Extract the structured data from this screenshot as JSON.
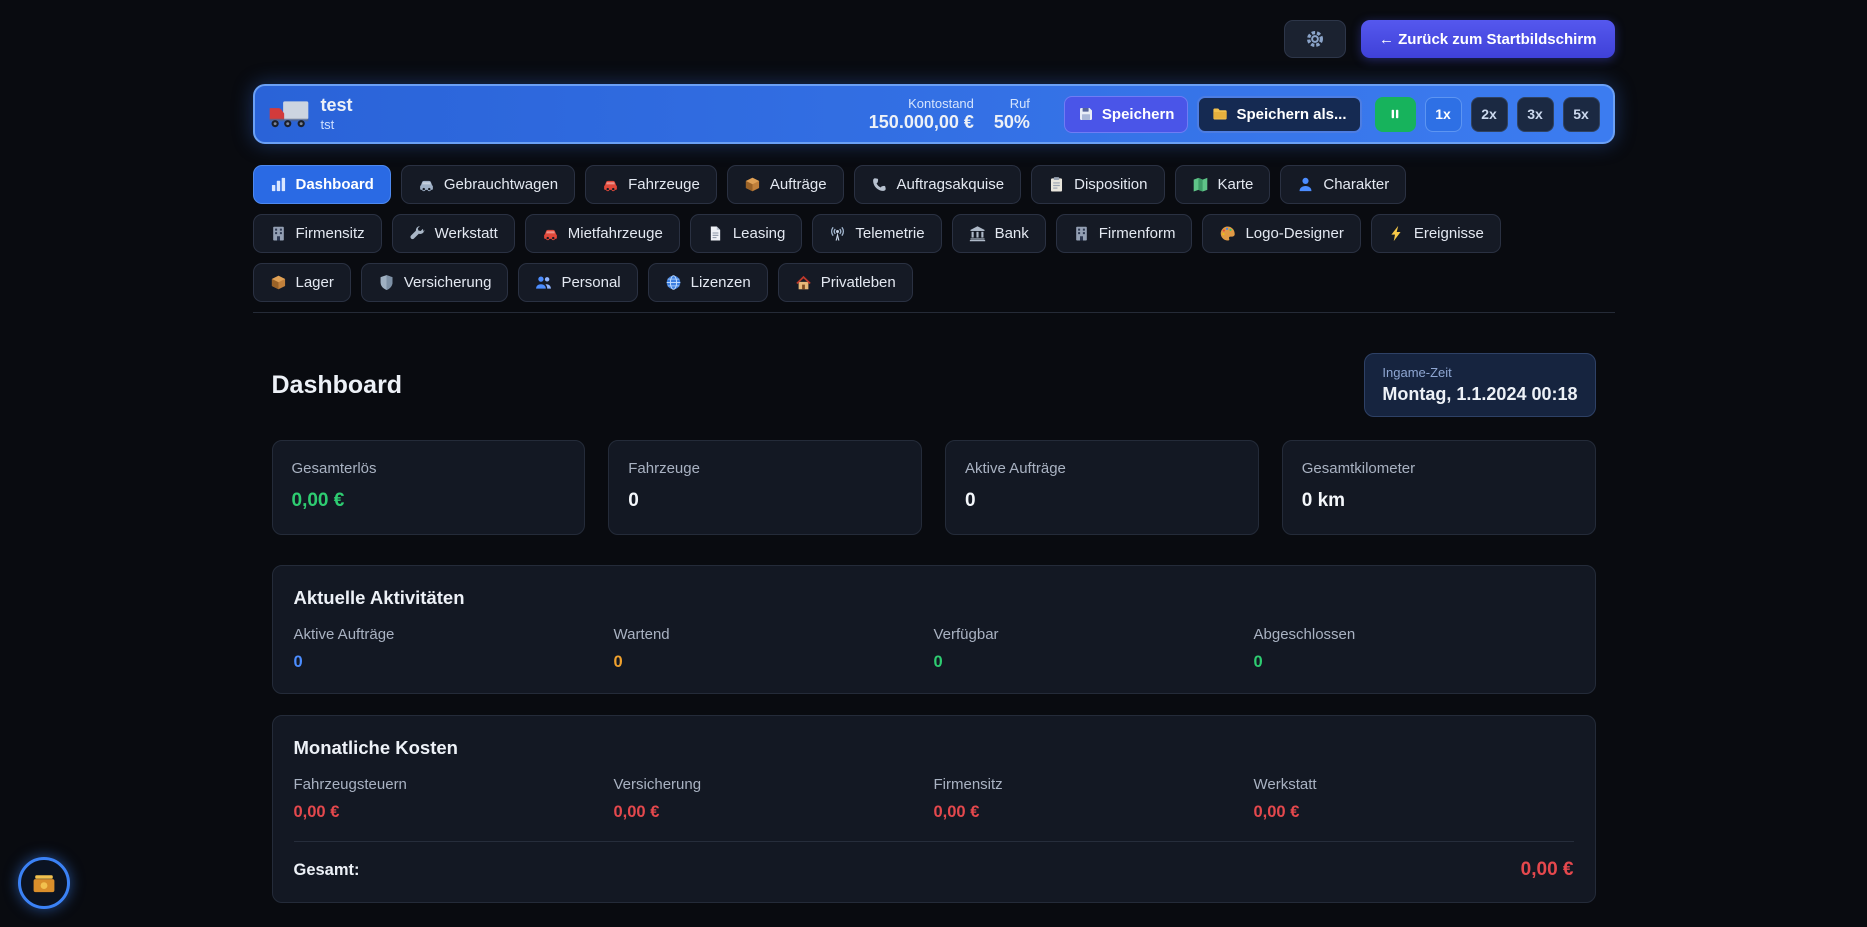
{
  "colors": {
    "accent_blue": "#2e6fe4",
    "green": "#2ecc71",
    "red": "#e5484d",
    "orange": "#f0a12e",
    "blue": "#4c8dff"
  },
  "topbar": {
    "settings_icon": "gear-icon",
    "back_button": "← Zurück zum Startbildschirm"
  },
  "header": {
    "logo_icon": "truck-icon",
    "company_name": "test",
    "company_sub": "tst",
    "balance_label": "Kontostand",
    "balance_value": "150.000,00 €",
    "reputation_label": "Ruf",
    "reputation_value": "50%",
    "save_button": "Speichern",
    "save_icon": "floppy-icon",
    "save_as_button": "Speichern als...",
    "save_as_icon": "folder-icon",
    "pause_icon": "pause-icon",
    "speed_buttons": [
      {
        "label": "1x",
        "active": true
      },
      {
        "label": "2x",
        "active": false
      },
      {
        "label": "3x",
        "active": false
      },
      {
        "label": "5x",
        "active": false
      }
    ]
  },
  "nav": {
    "rows": [
      [
        {
          "id": "dashboard",
          "label": "Dashboard",
          "icon": "chart-icon",
          "active": true
        },
        {
          "id": "gebrauchtwagen",
          "label": "Gebrauchtwagen",
          "icon": "car-gray-icon",
          "active": false
        },
        {
          "id": "fahrzeuge",
          "label": "Fahrzeuge",
          "icon": "car-red-icon",
          "active": false
        },
        {
          "id": "auftraege",
          "label": "Aufträge",
          "icon": "box-icon",
          "active": false
        },
        {
          "id": "auftragsakquise",
          "label": "Auftragsakquise",
          "icon": "phone-icon",
          "active": false
        },
        {
          "id": "disposition",
          "label": "Disposition",
          "icon": "clipboard-icon",
          "active": false
        },
        {
          "id": "karte",
          "label": "Karte",
          "icon": "map-icon",
          "active": false
        },
        {
          "id": "charakter",
          "label": "Charakter",
          "icon": "person-icon",
          "active": false
        }
      ],
      [
        {
          "id": "firmensitz",
          "label": "Firmensitz",
          "icon": "building-icon",
          "active": false
        },
        {
          "id": "werkstatt",
          "label": "Werkstatt",
          "icon": "wrench-icon",
          "active": false
        },
        {
          "id": "mietfahrzeuge",
          "label": "Mietfahrzeuge",
          "icon": "car-red-icon",
          "active": false
        },
        {
          "id": "leasing",
          "label": "Leasing",
          "icon": "document-icon",
          "active": false
        },
        {
          "id": "telemetrie",
          "label": "Telemetrie",
          "icon": "antenna-icon",
          "active": false
        },
        {
          "id": "bank",
          "label": "Bank",
          "icon": "bank-icon",
          "active": false
        },
        {
          "id": "firmenform",
          "label": "Firmenform",
          "icon": "building-icon",
          "active": false
        },
        {
          "id": "logo-designer",
          "label": "Logo-Designer",
          "icon": "palette-icon",
          "active": false
        },
        {
          "id": "ereignisse",
          "label": "Ereignisse",
          "icon": "lightning-icon",
          "active": false
        }
      ],
      [
        {
          "id": "lager",
          "label": "Lager",
          "icon": "box-icon",
          "active": false
        },
        {
          "id": "versicherung",
          "label": "Versicherung",
          "icon": "shield-icon",
          "active": false
        },
        {
          "id": "personal",
          "label": "Personal",
          "icon": "people-icon",
          "active": false
        },
        {
          "id": "lizenzen",
          "label": "Lizenzen",
          "icon": "globe-icon",
          "active": false
        },
        {
          "id": "privatleben",
          "label": "Privatleben",
          "icon": "house-icon",
          "active": false
        }
      ]
    ]
  },
  "main": {
    "title": "Dashboard",
    "time": {
      "label": "Ingame-Zeit",
      "value": "Montag, 1.1.2024 00:18"
    },
    "stats": [
      {
        "label": "Gesamterlös",
        "value": "0,00 €",
        "color": "green"
      },
      {
        "label": "Fahrzeuge",
        "value": "0",
        "color": "white"
      },
      {
        "label": "Aktive Aufträge",
        "value": "0",
        "color": "white"
      },
      {
        "label": "Gesamtkilometer",
        "value": "0 km",
        "color": "white"
      }
    ],
    "activities": {
      "title": "Aktuelle Aktivitäten",
      "items": [
        {
          "label": "Aktive Aufträge",
          "value": "0",
          "color": "blue"
        },
        {
          "label": "Wartend",
          "value": "0",
          "color": "orange"
        },
        {
          "label": "Verfügbar",
          "value": "0",
          "color": "green"
        },
        {
          "label": "Abgeschlossen",
          "value": "0",
          "color": "green"
        }
      ]
    },
    "costs": {
      "title": "Monatliche Kosten",
      "items": [
        {
          "label": "Fahrzeugsteuern",
          "value": "0,00 €",
          "color": "red"
        },
        {
          "label": "Versicherung",
          "value": "0,00 €",
          "color": "red"
        },
        {
          "label": "Firmensitz",
          "value": "0,00 €",
          "color": "red"
        },
        {
          "label": "Werkstatt",
          "value": "0,00 €",
          "color": "red"
        }
      ],
      "total_label": "Gesamt:",
      "total_value": "0,00 €"
    }
  },
  "fab": {
    "icon": "money-icon"
  }
}
